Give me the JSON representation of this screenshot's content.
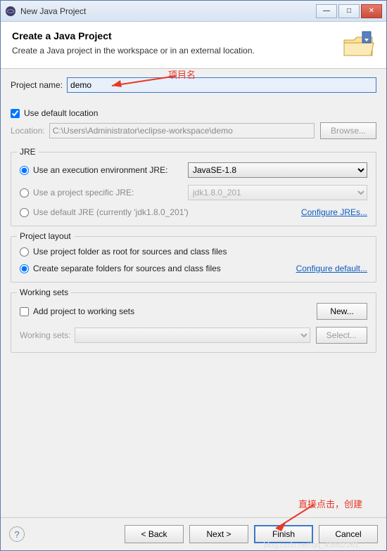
{
  "window": {
    "title": "New Java Project"
  },
  "header": {
    "title": "Create a Java Project",
    "subtitle": "Create a Java project in the workspace or in an external location."
  },
  "projectName": {
    "label": "Project name:",
    "value": "demo"
  },
  "useDefaultLocation": {
    "label": "Use default location",
    "checked": true
  },
  "location": {
    "label": "Location:",
    "value": "C:\\Users\\Administrator\\eclipse-workspace\\demo",
    "browse": "Browse..."
  },
  "jre": {
    "legend": "JRE",
    "execEnv": {
      "label": "Use an execution environment JRE:",
      "selected": "JavaSE-1.8"
    },
    "projectSpecific": {
      "label": "Use a project specific JRE:",
      "selected": "jdk1.8.0_201"
    },
    "defaultJre": {
      "label": "Use default JRE (currently 'jdk1.8.0_201')"
    },
    "configure": "Configure JREs..."
  },
  "layout": {
    "legend": "Project layout",
    "rootFolder": "Use project folder as root for sources and class files",
    "separate": "Create separate folders for sources and class files",
    "configure": "Configure default..."
  },
  "workingSets": {
    "legend": "Working sets",
    "add": "Add project to working sets",
    "new": "New...",
    "label": "Working sets:",
    "select": "Select..."
  },
  "footer": {
    "back": "< Back",
    "next": "Next >",
    "finish": "Finish",
    "cancel": "Cancel"
  },
  "annotations": {
    "projectNameNote": "项目名",
    "finishNote": "直接点击，创建"
  },
  "watermark": "blog.csdn.net/qq_43862261"
}
